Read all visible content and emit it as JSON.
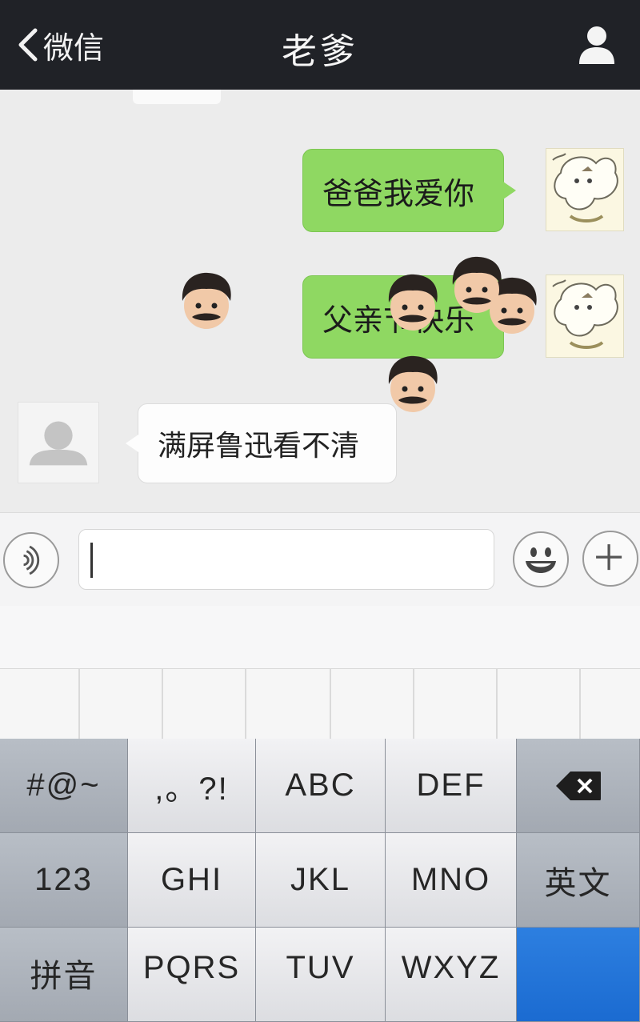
{
  "header": {
    "back_label": "微信",
    "title": "老爹"
  },
  "messages": [
    {
      "side": "out",
      "text": "爸爸我爱你"
    },
    {
      "side": "out",
      "text": "父亲节快乐"
    },
    {
      "side": "in",
      "text": "满屏鲁迅看不清"
    }
  ],
  "input": {
    "value": ""
  },
  "keyboard": {
    "rows": [
      [
        "#@~",
        ",。?!",
        "ABC",
        "DEF",
        "delete"
      ],
      [
        "123",
        "GHI",
        "JKL",
        "MNO",
        "英文"
      ],
      [
        "拼音",
        "PQRS",
        "TUV",
        "WXYZ",
        ""
      ]
    ]
  },
  "colors": {
    "header_bg": "#202227",
    "bubble_out": "#8fd862",
    "bubble_in": "#fdfdfd",
    "return_key": "#1b6bd1"
  },
  "icons": {
    "back": "chevron-left-icon",
    "profile": "person-icon",
    "voice": "voice-wave-icon",
    "emoji": "smiley-icon",
    "plus": "plus-icon",
    "delete": "backspace-icon",
    "sticker": "dad-face-emoji-icon"
  }
}
